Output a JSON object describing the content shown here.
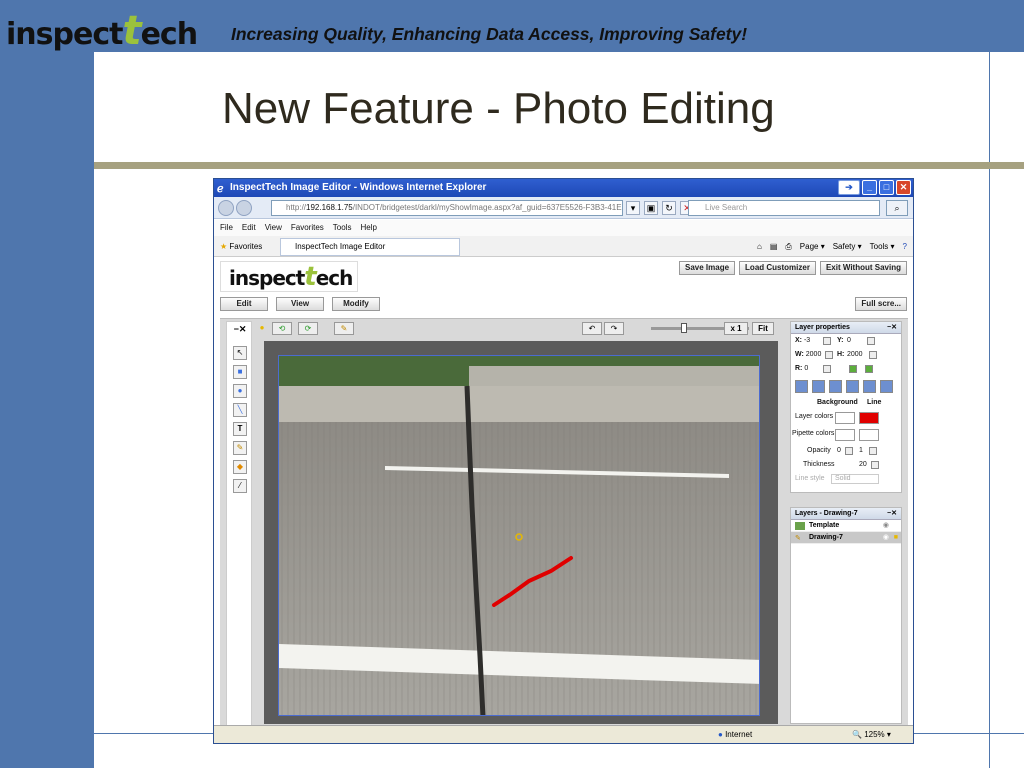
{
  "slide": {
    "logo_text_before": "inspect",
    "logo_text_t": "t",
    "logo_text_after": "ech",
    "tagline": "Increasing Quality, Enhancing Data Access, Improving Safety!",
    "title": "New Feature - Photo Editing"
  },
  "browser": {
    "window_title": "InspectTech Image Editor - Windows Internet Explorer",
    "url_prefix": "http://",
    "url_host": "192.168.1.75",
    "url_path": "/INDOT/bridgetest/darkl/myShowImage.aspx?af_guid=637E5526-F3B3-41E",
    "search_placeholder": "Live Search",
    "menu": [
      "File",
      "Edit",
      "View",
      "Favorites",
      "Tools",
      "Help"
    ],
    "favorites_label": "Favorites",
    "tab_label": "InspectTech Image Editor",
    "commands": [
      "Page ▾",
      "Safety ▾",
      "Tools ▾"
    ],
    "status_zone": "Internet",
    "zoom": "125%"
  },
  "app": {
    "logo_before": "inspect",
    "logo_t": "t",
    "logo_after": "ech",
    "save_image": "Save Image",
    "load_customizer": "Load Customizer",
    "exit_without_saving": "Exit Without Saving",
    "tabs": [
      "Edit",
      "View",
      "Modify"
    ],
    "full_screen": "Full scre...",
    "zoom_x1": "x 1",
    "fit": "Fit",
    "layer_properties": {
      "title": "Layer properties",
      "x_label": "X:",
      "x_value": "-3",
      "y_label": "Y:",
      "y_value": "0",
      "w_label": "W:",
      "w_value": "2000",
      "h_label": "H:",
      "h_value": "2000",
      "r_label": "R:",
      "r_value": "0",
      "background_header": "Background",
      "line_header": "Line",
      "layer_colors_label": "Layer colors",
      "pipette_colors_label": "Pipette colors",
      "opacity_label": "Opacity",
      "opacity_bg": "0",
      "opacity_line": "1",
      "thickness_label": "Thickness",
      "thickness_value": "20",
      "line_style_label": "Line style",
      "line_style_value": "Solid",
      "line_color": "#e00000"
    },
    "layers": {
      "title": "Layers - Drawing-7",
      "items": [
        "Template",
        "Drawing-7"
      ]
    }
  }
}
